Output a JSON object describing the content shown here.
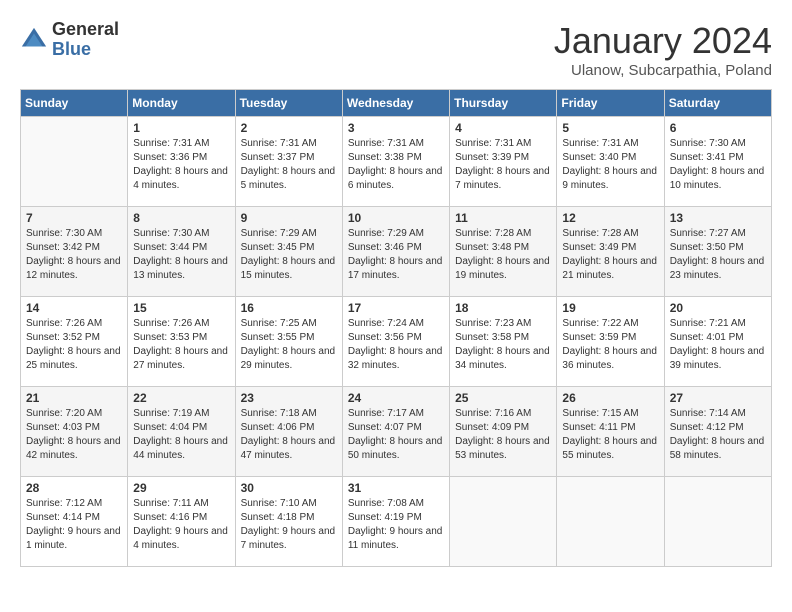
{
  "header": {
    "logo": {
      "general": "General",
      "blue": "Blue"
    },
    "title": "January 2024",
    "subtitle": "Ulanow, Subcarpathia, Poland"
  },
  "weekdays": [
    "Sunday",
    "Monday",
    "Tuesday",
    "Wednesday",
    "Thursday",
    "Friday",
    "Saturday"
  ],
  "weeks": [
    [
      {
        "day": "",
        "sunrise": "",
        "sunset": "",
        "daylight": ""
      },
      {
        "day": "1",
        "sunrise": "Sunrise: 7:31 AM",
        "sunset": "Sunset: 3:36 PM",
        "daylight": "Daylight: 8 hours and 4 minutes."
      },
      {
        "day": "2",
        "sunrise": "Sunrise: 7:31 AM",
        "sunset": "Sunset: 3:37 PM",
        "daylight": "Daylight: 8 hours and 5 minutes."
      },
      {
        "day": "3",
        "sunrise": "Sunrise: 7:31 AM",
        "sunset": "Sunset: 3:38 PM",
        "daylight": "Daylight: 8 hours and 6 minutes."
      },
      {
        "day": "4",
        "sunrise": "Sunrise: 7:31 AM",
        "sunset": "Sunset: 3:39 PM",
        "daylight": "Daylight: 8 hours and 7 minutes."
      },
      {
        "day": "5",
        "sunrise": "Sunrise: 7:31 AM",
        "sunset": "Sunset: 3:40 PM",
        "daylight": "Daylight: 8 hours and 9 minutes."
      },
      {
        "day": "6",
        "sunrise": "Sunrise: 7:30 AM",
        "sunset": "Sunset: 3:41 PM",
        "daylight": "Daylight: 8 hours and 10 minutes."
      }
    ],
    [
      {
        "day": "7",
        "sunrise": "Sunrise: 7:30 AM",
        "sunset": "Sunset: 3:42 PM",
        "daylight": "Daylight: 8 hours and 12 minutes."
      },
      {
        "day": "8",
        "sunrise": "Sunrise: 7:30 AM",
        "sunset": "Sunset: 3:44 PM",
        "daylight": "Daylight: 8 hours and 13 minutes."
      },
      {
        "day": "9",
        "sunrise": "Sunrise: 7:29 AM",
        "sunset": "Sunset: 3:45 PM",
        "daylight": "Daylight: 8 hours and 15 minutes."
      },
      {
        "day": "10",
        "sunrise": "Sunrise: 7:29 AM",
        "sunset": "Sunset: 3:46 PM",
        "daylight": "Daylight: 8 hours and 17 minutes."
      },
      {
        "day": "11",
        "sunrise": "Sunrise: 7:28 AM",
        "sunset": "Sunset: 3:48 PM",
        "daylight": "Daylight: 8 hours and 19 minutes."
      },
      {
        "day": "12",
        "sunrise": "Sunrise: 7:28 AM",
        "sunset": "Sunset: 3:49 PM",
        "daylight": "Daylight: 8 hours and 21 minutes."
      },
      {
        "day": "13",
        "sunrise": "Sunrise: 7:27 AM",
        "sunset": "Sunset: 3:50 PM",
        "daylight": "Daylight: 8 hours and 23 minutes."
      }
    ],
    [
      {
        "day": "14",
        "sunrise": "Sunrise: 7:26 AM",
        "sunset": "Sunset: 3:52 PM",
        "daylight": "Daylight: 8 hours and 25 minutes."
      },
      {
        "day": "15",
        "sunrise": "Sunrise: 7:26 AM",
        "sunset": "Sunset: 3:53 PM",
        "daylight": "Daylight: 8 hours and 27 minutes."
      },
      {
        "day": "16",
        "sunrise": "Sunrise: 7:25 AM",
        "sunset": "Sunset: 3:55 PM",
        "daylight": "Daylight: 8 hours and 29 minutes."
      },
      {
        "day": "17",
        "sunrise": "Sunrise: 7:24 AM",
        "sunset": "Sunset: 3:56 PM",
        "daylight": "Daylight: 8 hours and 32 minutes."
      },
      {
        "day": "18",
        "sunrise": "Sunrise: 7:23 AM",
        "sunset": "Sunset: 3:58 PM",
        "daylight": "Daylight: 8 hours and 34 minutes."
      },
      {
        "day": "19",
        "sunrise": "Sunrise: 7:22 AM",
        "sunset": "Sunset: 3:59 PM",
        "daylight": "Daylight: 8 hours and 36 minutes."
      },
      {
        "day": "20",
        "sunrise": "Sunrise: 7:21 AM",
        "sunset": "Sunset: 4:01 PM",
        "daylight": "Daylight: 8 hours and 39 minutes."
      }
    ],
    [
      {
        "day": "21",
        "sunrise": "Sunrise: 7:20 AM",
        "sunset": "Sunset: 4:03 PM",
        "daylight": "Daylight: 8 hours and 42 minutes."
      },
      {
        "day": "22",
        "sunrise": "Sunrise: 7:19 AM",
        "sunset": "Sunset: 4:04 PM",
        "daylight": "Daylight: 8 hours and 44 minutes."
      },
      {
        "day": "23",
        "sunrise": "Sunrise: 7:18 AM",
        "sunset": "Sunset: 4:06 PM",
        "daylight": "Daylight: 8 hours and 47 minutes."
      },
      {
        "day": "24",
        "sunrise": "Sunrise: 7:17 AM",
        "sunset": "Sunset: 4:07 PM",
        "daylight": "Daylight: 8 hours and 50 minutes."
      },
      {
        "day": "25",
        "sunrise": "Sunrise: 7:16 AM",
        "sunset": "Sunset: 4:09 PM",
        "daylight": "Daylight: 8 hours and 53 minutes."
      },
      {
        "day": "26",
        "sunrise": "Sunrise: 7:15 AM",
        "sunset": "Sunset: 4:11 PM",
        "daylight": "Daylight: 8 hours and 55 minutes."
      },
      {
        "day": "27",
        "sunrise": "Sunrise: 7:14 AM",
        "sunset": "Sunset: 4:12 PM",
        "daylight": "Daylight: 8 hours and 58 minutes."
      }
    ],
    [
      {
        "day": "28",
        "sunrise": "Sunrise: 7:12 AM",
        "sunset": "Sunset: 4:14 PM",
        "daylight": "Daylight: 9 hours and 1 minute."
      },
      {
        "day": "29",
        "sunrise": "Sunrise: 7:11 AM",
        "sunset": "Sunset: 4:16 PM",
        "daylight": "Daylight: 9 hours and 4 minutes."
      },
      {
        "day": "30",
        "sunrise": "Sunrise: 7:10 AM",
        "sunset": "Sunset: 4:18 PM",
        "daylight": "Daylight: 9 hours and 7 minutes."
      },
      {
        "day": "31",
        "sunrise": "Sunrise: 7:08 AM",
        "sunset": "Sunset: 4:19 PM",
        "daylight": "Daylight: 9 hours and 11 minutes."
      },
      {
        "day": "",
        "sunrise": "",
        "sunset": "",
        "daylight": ""
      },
      {
        "day": "",
        "sunrise": "",
        "sunset": "",
        "daylight": ""
      },
      {
        "day": "",
        "sunrise": "",
        "sunset": "",
        "daylight": ""
      }
    ]
  ]
}
